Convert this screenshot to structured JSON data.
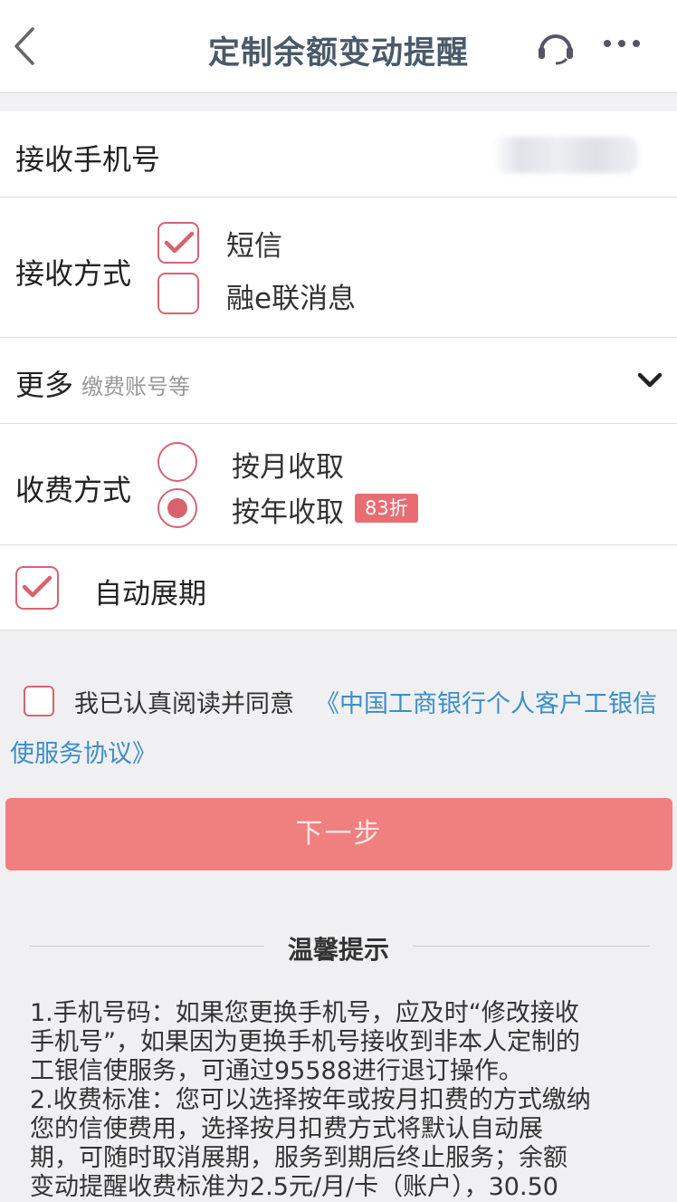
{
  "header": {
    "title": "定制余额变动提醒",
    "back_icon": "chevron-left-icon",
    "service_icon": "headset-icon",
    "more_icon": "ellipsis-icon"
  },
  "phone": {
    "label": "接收手机号"
  },
  "receive": {
    "label": "接收方式",
    "sms_label": "短信",
    "sms_checked": true,
    "rongelian_label": "融e联消息",
    "rongelian_checked": false
  },
  "more": {
    "label": "更多",
    "hint": "缴费账号等"
  },
  "fee": {
    "label": "收费方式",
    "monthly_label": "按月收取",
    "yearly_label": "按年收取",
    "selected": "yearly",
    "badge": "83折"
  },
  "renew": {
    "label": "自动展期",
    "checked": true
  },
  "agreement": {
    "text": "我已认真阅读并同意",
    "link_part1": "《中国工商银行个人客户工银信",
    "link_part2": "使服务协议》",
    "checked": false
  },
  "next_button": {
    "label": "下一步"
  },
  "tips": {
    "title": "温馨提示",
    "lines": [
      "1.手机号码：如果您更换手机号，应及时“修改接收",
      "手机号”，如果因为更换手机号接收到非本人定制的",
      "工银信使服务，可通过95588进行退订操作。",
      "2.收费标准：您可以选择按年或按月扣费的方式缴纳",
      "您的信使费用，选择按月扣费方式将默认自动展",
      "期，可随时取消展期，服务到期后终止服务；余额",
      "变动提醒收费标准为2.5元/月/卡（账户），30.50"
    ]
  },
  "colors": {
    "accent": "#d8636f",
    "button": "#f08080",
    "link": "#3d8ec9",
    "badge": "#e86d73"
  }
}
